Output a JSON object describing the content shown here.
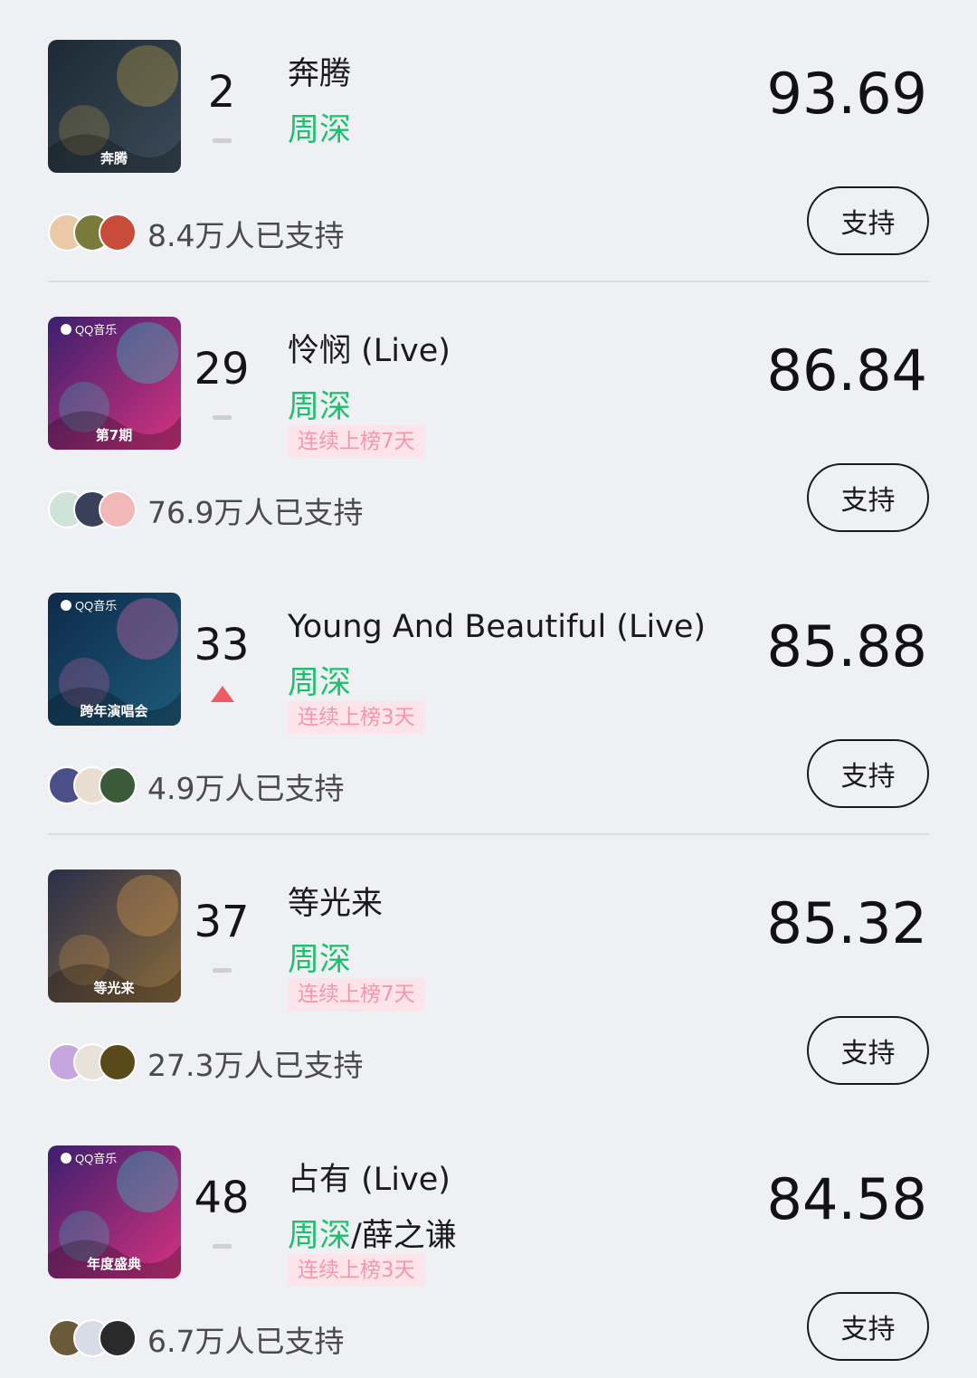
{
  "support_label": "支持",
  "entries": [
    {
      "rank": "2",
      "trend": "flat",
      "title": "奔腾",
      "artist_highlight": "周深",
      "artist_rest": "",
      "streak": "",
      "score": "93.69",
      "supporters": "8.4万人已支持",
      "cover": {
        "bg1": "#1d2a36",
        "bg2": "#3a4a56",
        "accent": "#c9a54a",
        "text": "奔腾"
      },
      "avatar_colors": [
        "#e9c9a6",
        "#7a7a3a",
        "#c94b3a"
      ]
    },
    {
      "rank": "29",
      "trend": "flat",
      "title": "怜悯 (Live)",
      "artist_highlight": "周深",
      "artist_rest": "",
      "streak": "连续上榜7天",
      "score": "86.84",
      "supporters": "76.9万人已支持",
      "cover": {
        "bg1": "#3b1f6e",
        "bg2": "#d6327e",
        "accent": "#2ad4c9",
        "text": "第7期",
        "brand": "QQ音乐"
      },
      "avatar_colors": [
        "#cfe3d8",
        "#3a3f5a",
        "#f2b8b8"
      ]
    },
    {
      "rank": "33",
      "trend": "up",
      "title": "Young And Beautiful (Live)",
      "artist_highlight": "周深",
      "artist_rest": "",
      "streak": "连续上榜3天",
      "score": "85.88",
      "supporters": "4.9万人已支持",
      "cover": {
        "bg1": "#0e2a4a",
        "bg2": "#1d5a7a",
        "accent": "#e86bb0",
        "text": "跨年演唱会",
        "brand": "QQ音乐"
      },
      "avatar_colors": [
        "#4a4f8a",
        "#e8ddd0",
        "#3a5a3a"
      ]
    },
    {
      "rank": "37",
      "trend": "flat",
      "title": "等光来",
      "artist_highlight": "周深",
      "artist_rest": "",
      "streak": "连续上榜7天",
      "score": "85.32",
      "supporters": "27.3万人已支持",
      "cover": {
        "bg1": "#2a2f4a",
        "bg2": "#8a6a3a",
        "accent": "#e0a050",
        "text": "等光来"
      },
      "avatar_colors": [
        "#c7a6e0",
        "#e9e2d8",
        "#5a4a1a"
      ]
    },
    {
      "rank": "48",
      "trend": "flat",
      "title": "占有 (Live)",
      "artist_highlight": "周深",
      "artist_rest": "/薛之谦",
      "streak": "连续上榜3天",
      "score": "84.58",
      "supporters": "6.7万人已支持",
      "cover": {
        "bg1": "#3b1f6e",
        "bg2": "#d6327e",
        "accent": "#2ad4c9",
        "text": "年度盛典",
        "brand": "QQ音乐"
      },
      "avatar_colors": [
        "#6a5a3a",
        "#d8dce6",
        "#2a2a2a"
      ]
    }
  ]
}
